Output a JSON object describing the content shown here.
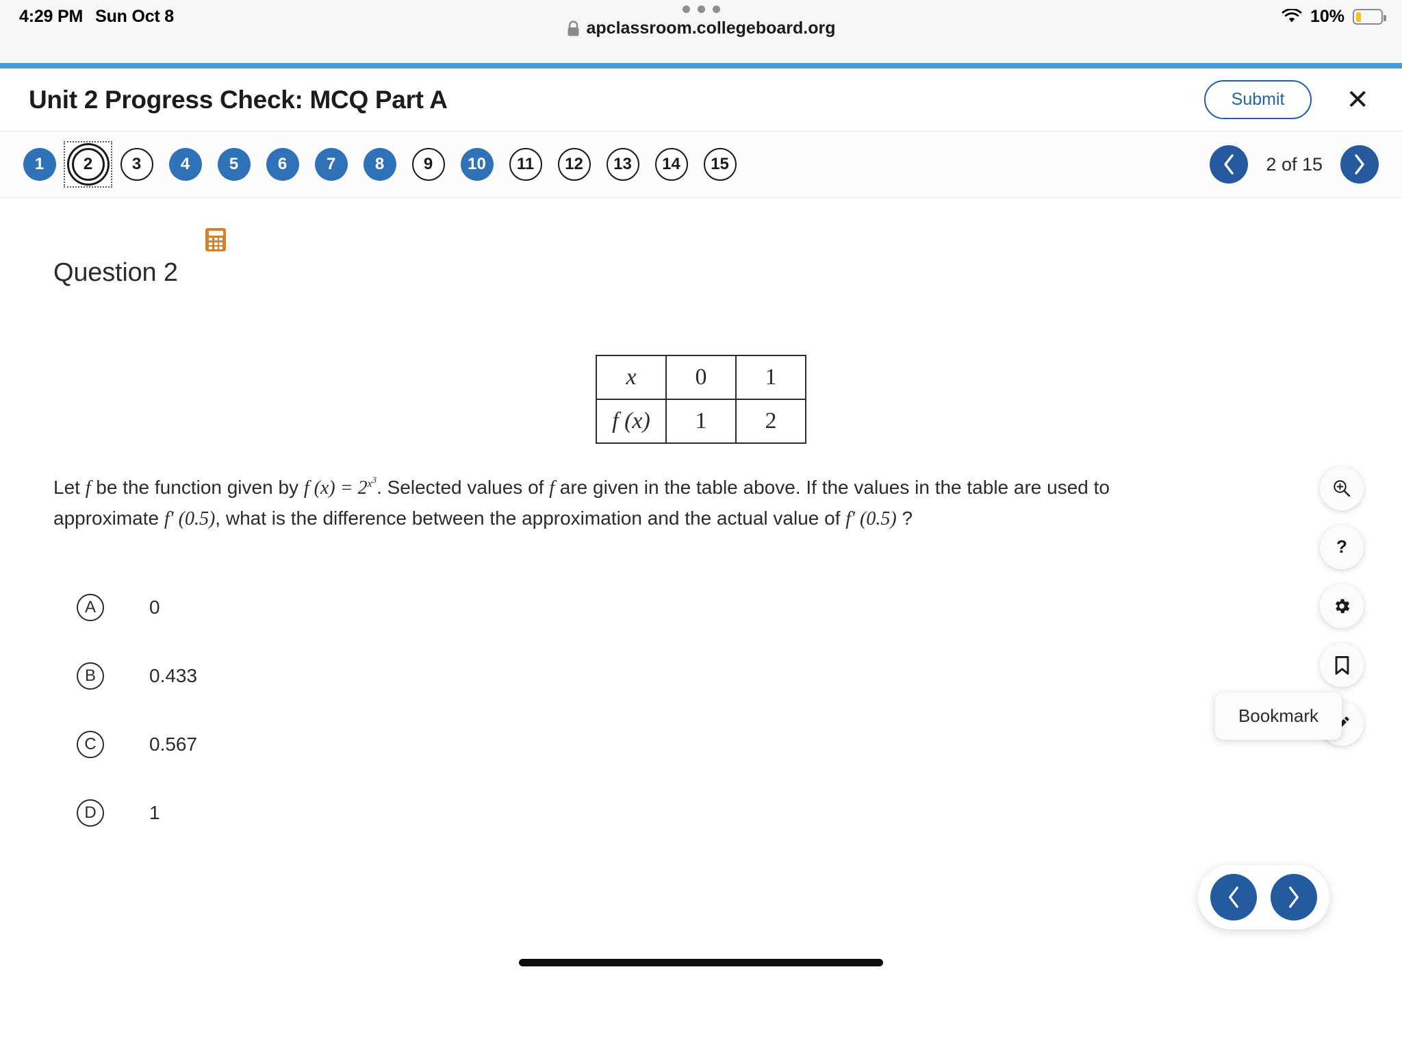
{
  "status_bar": {
    "time": "4:29 PM",
    "date": "Sun Oct 8",
    "battery_percent": "10%",
    "wifi_icon": "wifi-icon",
    "battery_icon": "battery-icon",
    "battery_fill_color": "#f5c518"
  },
  "browser": {
    "url": "apclassroom.collegeboard.org",
    "lock_icon": "lock-icon",
    "tab_dots_icon": "tab-overview-dots-icon",
    "progress_color": "#459ad7"
  },
  "header": {
    "title": "Unit 2 Progress Check: MCQ Part A",
    "submit_label": "Submit",
    "close_icon": "close-icon",
    "accent_color": "#1f63ad"
  },
  "nav": {
    "questions": [
      {
        "number": "1",
        "state": "answered"
      },
      {
        "number": "2",
        "state": "current"
      },
      {
        "number": "3",
        "state": "unanswered"
      },
      {
        "number": "4",
        "state": "answered"
      },
      {
        "number": "5",
        "state": "answered"
      },
      {
        "number": "6",
        "state": "answered"
      },
      {
        "number": "7",
        "state": "answered"
      },
      {
        "number": "8",
        "state": "answered"
      },
      {
        "number": "9",
        "state": "unanswered"
      },
      {
        "number": "10",
        "state": "answered"
      },
      {
        "number": "11",
        "state": "unanswered"
      },
      {
        "number": "12",
        "state": "unanswered"
      },
      {
        "number": "13",
        "state": "unanswered"
      },
      {
        "number": "14",
        "state": "unanswered"
      },
      {
        "number": "15",
        "state": "unanswered"
      }
    ],
    "pager_label": "2 of 15",
    "prev_icon": "chevron-left-icon",
    "next_icon": "chevron-right-icon",
    "answered_color": "#2f72b8",
    "pager_color": "#255a9e"
  },
  "question": {
    "calculator_icon": "calculator-icon",
    "calculator_color": "#d77f2c",
    "title": "Question 2",
    "table": {
      "row_labels": [
        "x",
        "f (x)"
      ],
      "rows": [
        [
          "x",
          "0",
          "1"
        ],
        [
          "f (x)",
          "1",
          "2"
        ]
      ]
    },
    "stem": {
      "part1": "Let ",
      "f1": "f",
      "part2": " be the function given by ",
      "fx_eq": "f (x) = 2",
      "exponent": "x",
      "exponent_sup": "3",
      "part3": ". Selected values of ",
      "f2": "f",
      "part4": " are given in the table above. If the values in the table are used to approximate ",
      "fprime1": "f' (0.5)",
      "part5": ", what is the difference between the approximation and the actual value of ",
      "fprime2": "f' (0.5)",
      "part6": " ?"
    },
    "choices": [
      {
        "letter": "A",
        "text": "0"
      },
      {
        "letter": "B",
        "text": "0.433"
      },
      {
        "letter": "C",
        "text": "0.567"
      },
      {
        "letter": "D",
        "text": "1"
      }
    ]
  },
  "tools": {
    "zoom_icon": "zoom-in-icon",
    "help_icon": "question-mark-icon",
    "settings_icon": "gear-icon",
    "bookmark_icon": "bookmark-icon",
    "annotate_icon": "pencil-icon",
    "tooltip_label": "Bookmark"
  },
  "bottom_pager": {
    "prev_icon": "chevron-left-icon",
    "next_icon": "chevron-right-icon"
  }
}
